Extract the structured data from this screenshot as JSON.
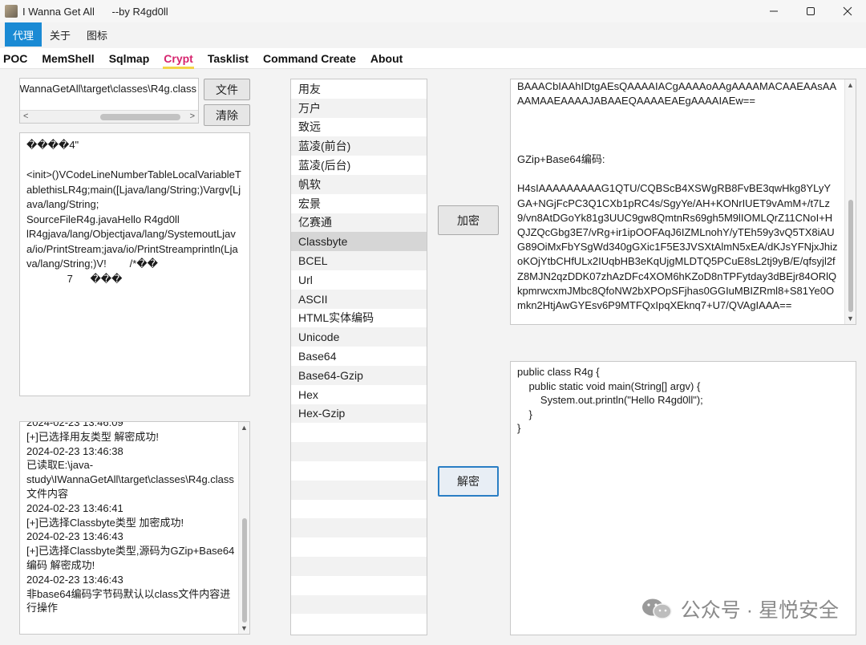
{
  "window": {
    "title": "I Wanna Get All      --by R4gd0ll",
    "minimize_symbol": "—",
    "maximize_symbol": "☐",
    "close_symbol": "✕"
  },
  "menubar": {
    "items": [
      "代理",
      "关于",
      "图标"
    ],
    "active_index": 0
  },
  "tabs": {
    "items": [
      "POC",
      "MemShell",
      "Sqlmap",
      "Crypt",
      "Tasklist",
      "Command Create",
      "About"
    ],
    "active": "Crypt"
  },
  "file_panel": {
    "path_value": "E:\\java-study\\IWannaGetAll\\target\\classes\\R4g.class",
    "file_button": "文件",
    "clear_button": "清除"
  },
  "bytes_preview": "����4\"\n\n<init>()VCodeLineNumberTableLocalVariableTablethisLR4g;main([Ljava/lang/String;)Vargv[Ljava/lang/String;\nSourceFileR4g.javaHello R4gd0ll\nlR4gjava/lang/Objectjava/lang/SystemoutLjava/io/PrintStream;java/io/PrintStreamprintln(Ljava/lang/String;)V!        /*��\n              7      ���",
  "log_text": "2024-02-23 13:46:09\n[+]已选择用友类型 解密成功!\n2024-02-23 13:46:38\n已读取E:\\java-study\\IWannaGetAll\\target\\classes\\R4g.class文件内容\n2024-02-23 13:46:41\n[+]已选择Classbyte类型 加密成功!\n2024-02-23 13:46:43\n[+]已选择Classbyte类型,源码为GZip+Base64编码 解密成功!\n2024-02-23 13:46:43\n非base64编码字节码默认以class文件内容进行操作",
  "types": {
    "items": [
      "用友",
      "万户",
      "致远",
      "蓝凌(前台)",
      "蓝凌(后台)",
      "帆软",
      "宏景",
      "亿赛通",
      "Classbyte",
      "BCEL",
      "Url",
      "ASCII",
      "HTML实体编码",
      "Unicode",
      "Base64",
      "Base64-Gzip",
      "Hex",
      "Hex-Gzip"
    ],
    "selected": "Classbyte"
  },
  "actions": {
    "encrypt": "加密",
    "decrypt": "解密"
  },
  "encrypt_output": "BAAACbIAAhIDtgAEsQAAAAIACgAAAAoAAgAAAAMACAAEAAsAAAAMAAEAAAAJABAAEQAAAAEAEgAAAAIAEw==\n\n\n\nGZip+Base64编码:\n\nH4sIAAAAAAAAAG1QTU/CQBScB4XSWgRB8FvBE3qwHkg8YLyYGA+NGjFcPC3Q1CXb1pRC4s/SgyYe/AH+KONrIUET9vAmM+/t7Lz9/vn8AtDGoYk81g3UUC9gw8QmtnRs69gh5M9lIOMLQrZ11CNoI+HQJZQcGbg3E7/vRg+ir1ipOOFAqJ6IZMLnohY/yTEh59y3vQ5TX8iAUG89OiMxFbYSgWd340gGXic1F5E3JVSXtAlmN5xEA/dKJsYFNjxJhizoKOjYtbCHfULx2IUqbHB3eKqUjgMLDTQ5PCuE8sL2tj9yB/E/qfsyjl2fZ8MJN2qzDDK07zhAzDFc4XOM6hKZoD8nTPFytday3dBEjr84ORlQkpmrwcxmJMbc8QfoNW2bXPOpSFjhas0GGIuMBIZRml8+S81Ye0Omkn2HtjAwGYEsv6P9MTFQxIpqXEknq7+U7/QVAgIAAA==",
  "source_code": "public class R4g {\n    public static void main(String[] argv) {\n        System.out.println(\"Hello R4gd0ll\");\n    }\n}",
  "watermark": "公众号 · 星悦安全"
}
